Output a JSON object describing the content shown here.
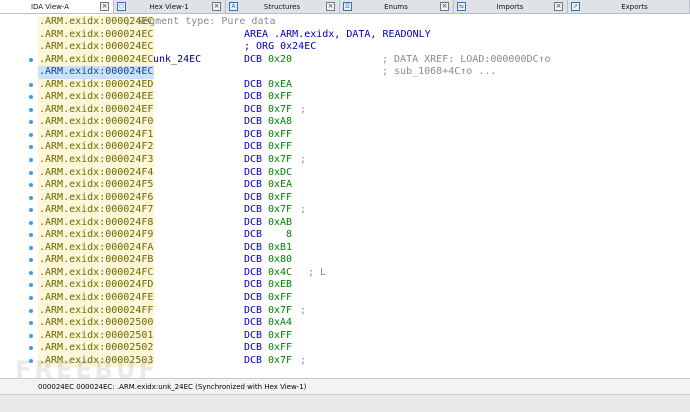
{
  "tabs": [
    {
      "label": "IDA View-A",
      "icon": "",
      "active": true
    },
    {
      "label": "Hex View-1",
      "icon": "⬡",
      "active": false
    },
    {
      "label": "Structures",
      "icon": "A",
      "active": false
    },
    {
      "label": "Enums",
      "icon": "☰",
      "active": false
    },
    {
      "label": "Imports",
      "icon": "⇆",
      "active": false
    },
    {
      "label": "Exports",
      "icon": "⇗",
      "active": false
    }
  ],
  "close_glyph": "×",
  "listing": [
    {
      "addr": ".ARM.exidx:000024EC",
      "comment": "; Segment type: Pure data"
    },
    {
      "addr": ".ARM.exidx:000024EC",
      "directive": "AREA .ARM.exidx, DATA, READONLY"
    },
    {
      "addr": ".ARM.exidx:000024EC",
      "directive_comment": "; ORG 0x24EC"
    },
    {
      "addr": ".ARM.exidx:000024EC",
      "label": "unk_24EC",
      "ins": "DCB",
      "opd": "0x20",
      "xref": "; DATA XREF: LOAD:000000DC↑o",
      "dot": true
    },
    {
      "addr": ".ARM.exidx:000024EC",
      "xref": "; sub_1068+4C↑o ...",
      "highlight": true
    },
    {
      "addr": ".ARM.exidx:000024ED",
      "ins": "DCB",
      "opd": "0xEA",
      "dot": true
    },
    {
      "addr": ".ARM.exidx:000024EE",
      "ins": "DCB",
      "opd": "0xFF",
      "dot": true
    },
    {
      "addr": ".ARM.exidx:000024EF",
      "ins": "DCB",
      "opd": "0x7F",
      "sep": ";",
      "dot": true
    },
    {
      "addr": ".ARM.exidx:000024F0",
      "ins": "DCB",
      "opd": "0xA8",
      "dot": true
    },
    {
      "addr": ".ARM.exidx:000024F1",
      "ins": "DCB",
      "opd": "0xFF",
      "dot": true
    },
    {
      "addr": ".ARM.exidx:000024F2",
      "ins": "DCB",
      "opd": "0xFF",
      "dot": true
    },
    {
      "addr": ".ARM.exidx:000024F3",
      "ins": "DCB",
      "opd": "0x7F",
      "sep": ";",
      "dot": true
    },
    {
      "addr": ".ARM.exidx:000024F4",
      "ins": "DCB",
      "opd": "0xDC",
      "dot": true
    },
    {
      "addr": ".ARM.exidx:000024F5",
      "ins": "DCB",
      "opd": "0xEA",
      "dot": true
    },
    {
      "addr": ".ARM.exidx:000024F6",
      "ins": "DCB",
      "opd": "0xFF",
      "dot": true
    },
    {
      "addr": ".ARM.exidx:000024F7",
      "ins": "DCB",
      "opd": "0x7F",
      "sep": ";",
      "dot": true
    },
    {
      "addr": ".ARM.exidx:000024F8",
      "ins": "DCB",
      "opd": "0xAB",
      "dot": true
    },
    {
      "addr": ".ARM.exidx:000024F9",
      "ins": "DCB",
      "opd": "   8",
      "dot": true
    },
    {
      "addr": ".ARM.exidx:000024FA",
      "ins": "DCB",
      "opd": "0xB1",
      "dot": true
    },
    {
      "addr": ".ARM.exidx:000024FB",
      "ins": "DCB",
      "opd": "0x80",
      "dot": true
    },
    {
      "addr": ".ARM.exidx:000024FC",
      "ins": "DCB",
      "opd": "0x4C",
      "sep": "; L",
      "dot": true
    },
    {
      "addr": ".ARM.exidx:000024FD",
      "ins": "DCB",
      "opd": "0xEB",
      "dot": true
    },
    {
      "addr": ".ARM.exidx:000024FE",
      "ins": "DCB",
      "opd": "0xFF",
      "dot": true
    },
    {
      "addr": ".ARM.exidx:000024FF",
      "ins": "DCB",
      "opd": "0x7F",
      "sep": ";",
      "dot": true
    },
    {
      "addr": ".ARM.exidx:00002500",
      "ins": "DCB",
      "opd": "0xA4",
      "dot": true
    },
    {
      "addr": ".ARM.exidx:00002501",
      "ins": "DCB",
      "opd": "0xFF",
      "dot": true
    },
    {
      "addr": ".ARM.exidx:00002502",
      "ins": "DCB",
      "opd": "0xFF",
      "dot": true
    },
    {
      "addr": ".ARM.exidx:00002503",
      "ins": "DCB",
      "opd": "0x7F",
      "sep": ";",
      "dot": true
    }
  ],
  "status": {
    "text": "000024EC 000024EC: .ARM.exidx:unk_24EC (Synchronized with Hex View-1)"
  },
  "watermark": {
    "text": "FREEBUF"
  },
  "colors": {
    "address": "#6b6b00",
    "address_bg": "#fdf6d8",
    "mnemonic": "#0000b0",
    "operand": "#008000",
    "comment": "#8a8a8a",
    "gutter_dot": "#3aa0e6"
  }
}
